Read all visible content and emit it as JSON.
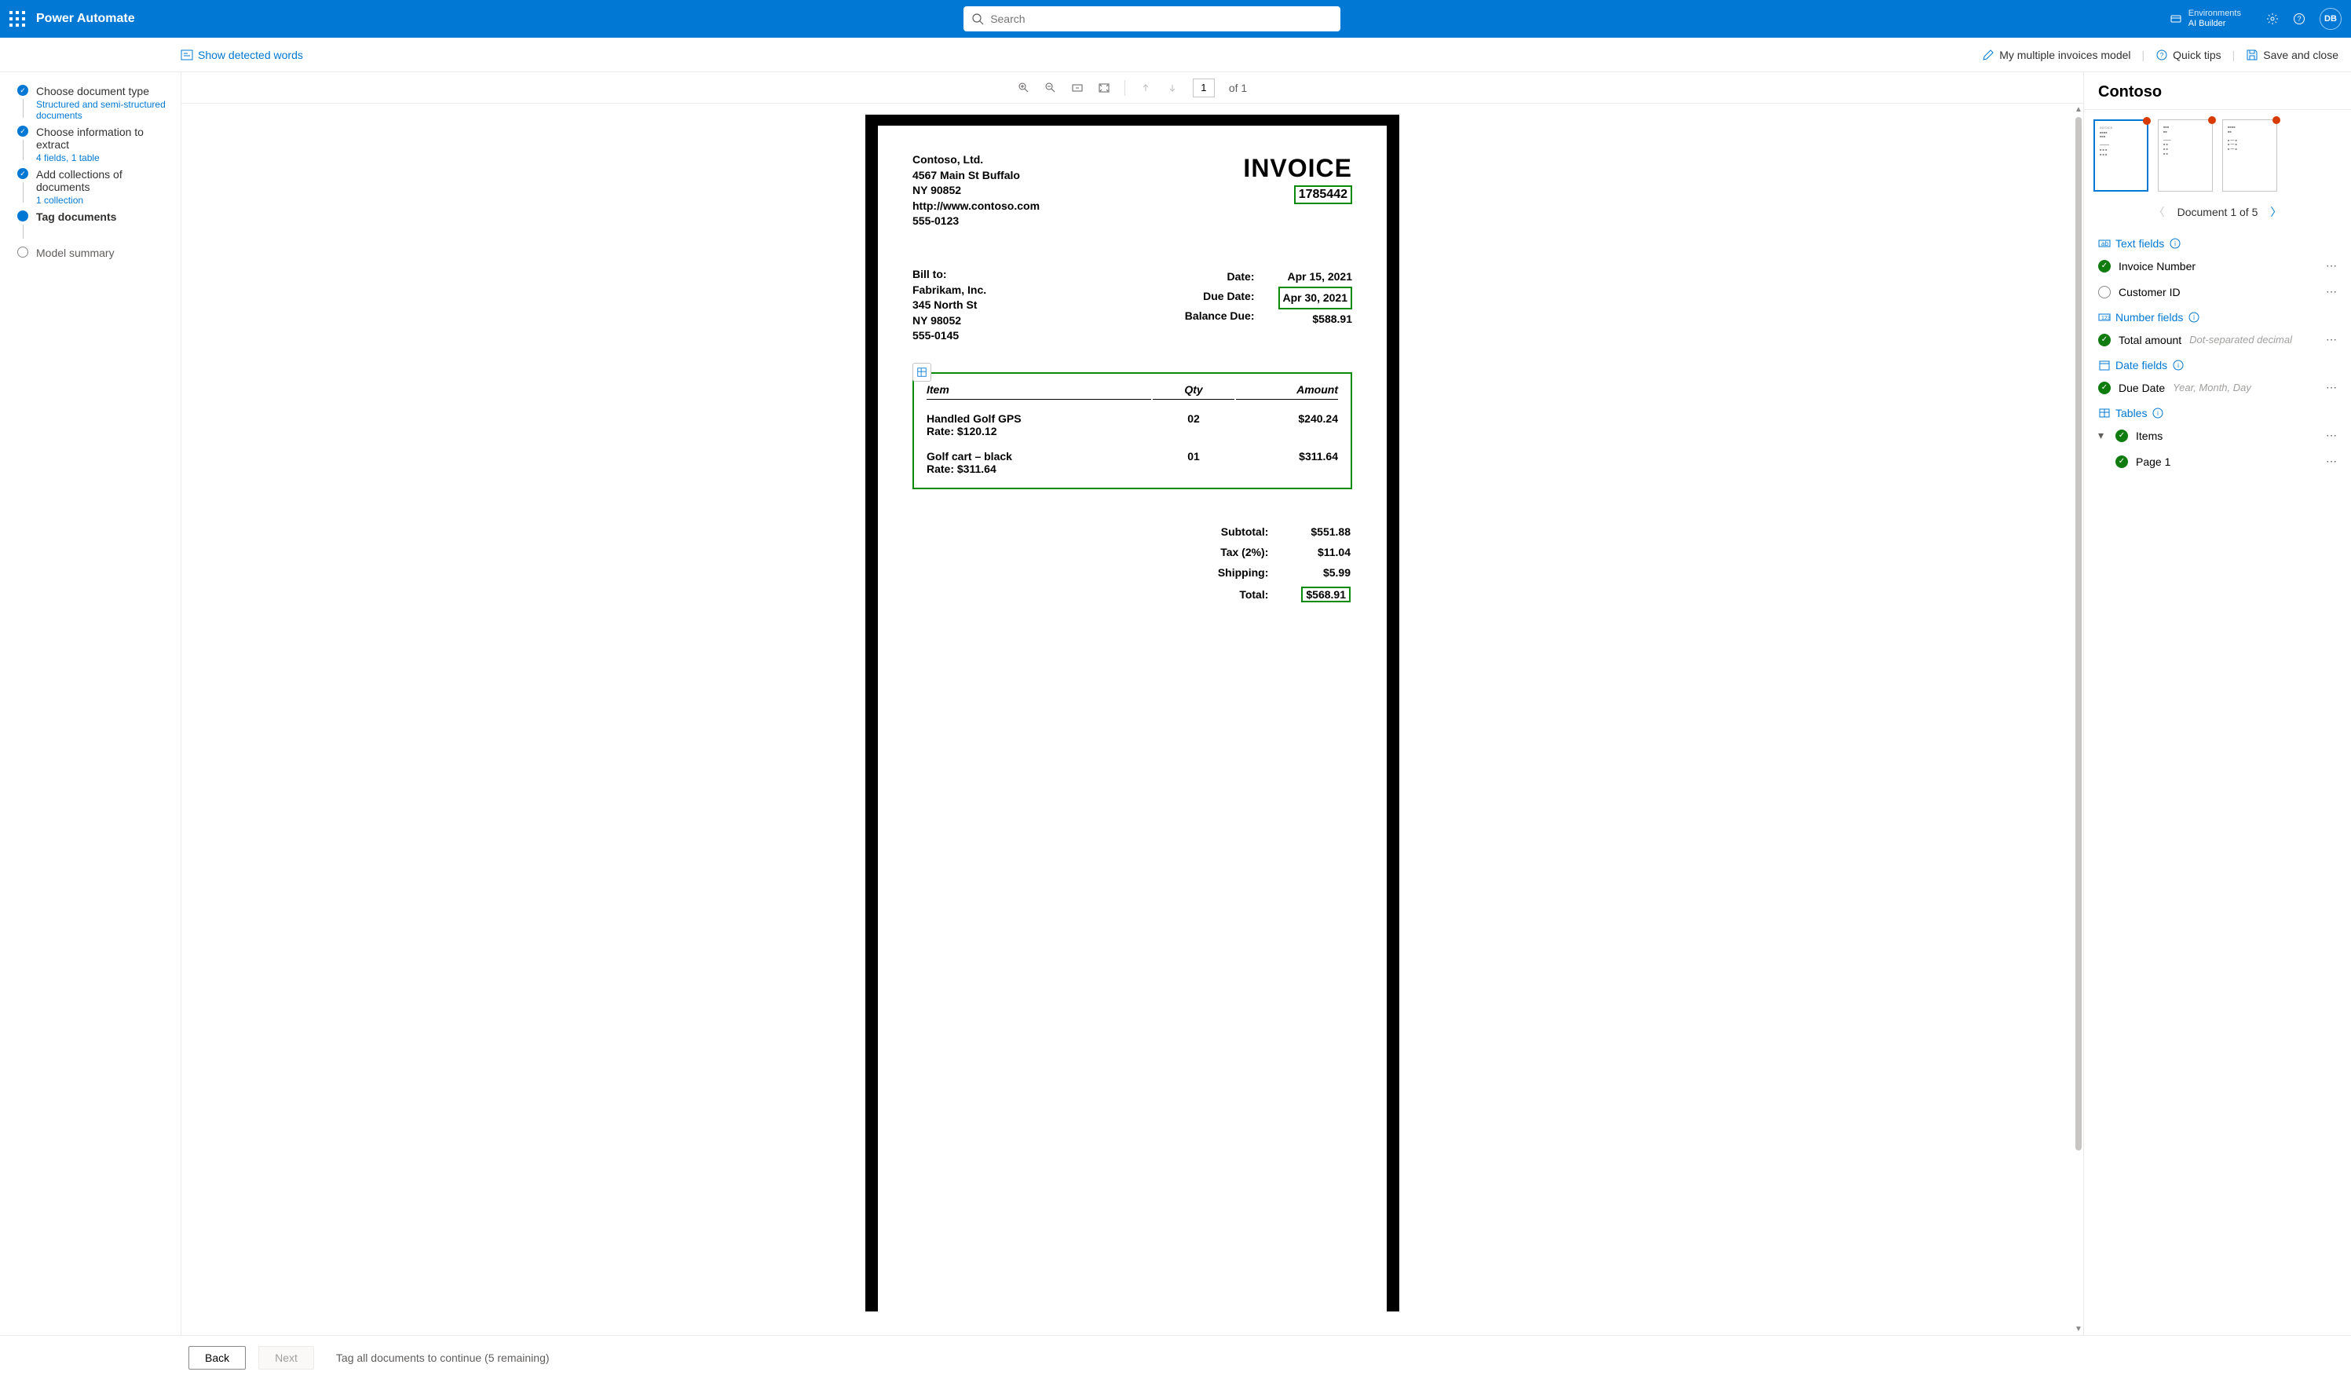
{
  "header": {
    "app_title": "Power Automate",
    "search_placeholder": "Search",
    "env_label": "Environments",
    "env_name": "AI Builder",
    "avatar": "DB"
  },
  "cmdbar": {
    "show_detected": "Show detected words",
    "model_name": "My multiple invoices model",
    "quick_tips": "Quick tips",
    "save_close": "Save and close"
  },
  "stepper": [
    {
      "title": "Choose document type",
      "sub": "Structured and semi-structured documents",
      "state": "done"
    },
    {
      "title": "Choose information to extract",
      "sub": "4 fields, 1 table",
      "state": "done"
    },
    {
      "title": "Add collections of documents",
      "sub": "1 collection",
      "state": "done"
    },
    {
      "title": "Tag documents",
      "sub": "",
      "state": "current"
    },
    {
      "title": "Model summary",
      "sub": "",
      "state": "todo"
    }
  ],
  "viewer": {
    "page_current": "1",
    "page_total": "of 1"
  },
  "document": {
    "company": {
      "name": "Contoso, Ltd.",
      "addr1": "4567 Main St Buffalo",
      "addr2": "NY 90852",
      "url": "http://www.contoso.com",
      "phone": "555-0123"
    },
    "invoice_title": "INVOICE",
    "invoice_number": "1785442",
    "bill_to_label": "Bill to:",
    "bill_to": {
      "name": "Fabrikam, Inc.",
      "addr1": "345 North St",
      "addr2": "NY 98052",
      "phone": "555-0145"
    },
    "meta_labels": {
      "date": "Date:",
      "due": "Due Date:",
      "balance": "Balance Due:"
    },
    "meta_values": {
      "date": "Apr 15, 2021",
      "due": "Apr 30, 2021",
      "balance": "$588.91"
    },
    "table": {
      "headers": [
        "Item",
        "Qty",
        "Amount"
      ],
      "rows": [
        {
          "item": "Handled Golf GPS",
          "rate": "Rate: $120.12",
          "qty": "02",
          "amount": "$240.24"
        },
        {
          "item": "Golf cart – black",
          "rate": "Rate: $311.64",
          "qty": "01",
          "amount": "$311.64"
        }
      ]
    },
    "totals": [
      {
        "label": "Subtotal:",
        "value": "$551.88"
      },
      {
        "label": "Tax (2%):",
        "value": "$11.04"
      },
      {
        "label": "Shipping:",
        "value": "$5.99"
      },
      {
        "label": "Total:",
        "value": "$568.91"
      }
    ]
  },
  "rpanel": {
    "title": "Contoso",
    "doc_nav": "Document 1 of 5",
    "sections": {
      "text_fields": "Text fields",
      "number_fields": "Number fields",
      "date_fields": "Date fields",
      "tables": "Tables"
    },
    "fields": {
      "invoice_number": "Invoice Number",
      "customer_id": "Customer ID",
      "total_amount": "Total amount",
      "total_amount_hint": "Dot-separated decimal",
      "due_date": "Due Date",
      "due_date_hint": "Year, Month, Day",
      "items": "Items",
      "page1": "Page 1"
    }
  },
  "footer": {
    "back": "Back",
    "next": "Next",
    "msg": "Tag all documents to continue (5 remaining)"
  }
}
